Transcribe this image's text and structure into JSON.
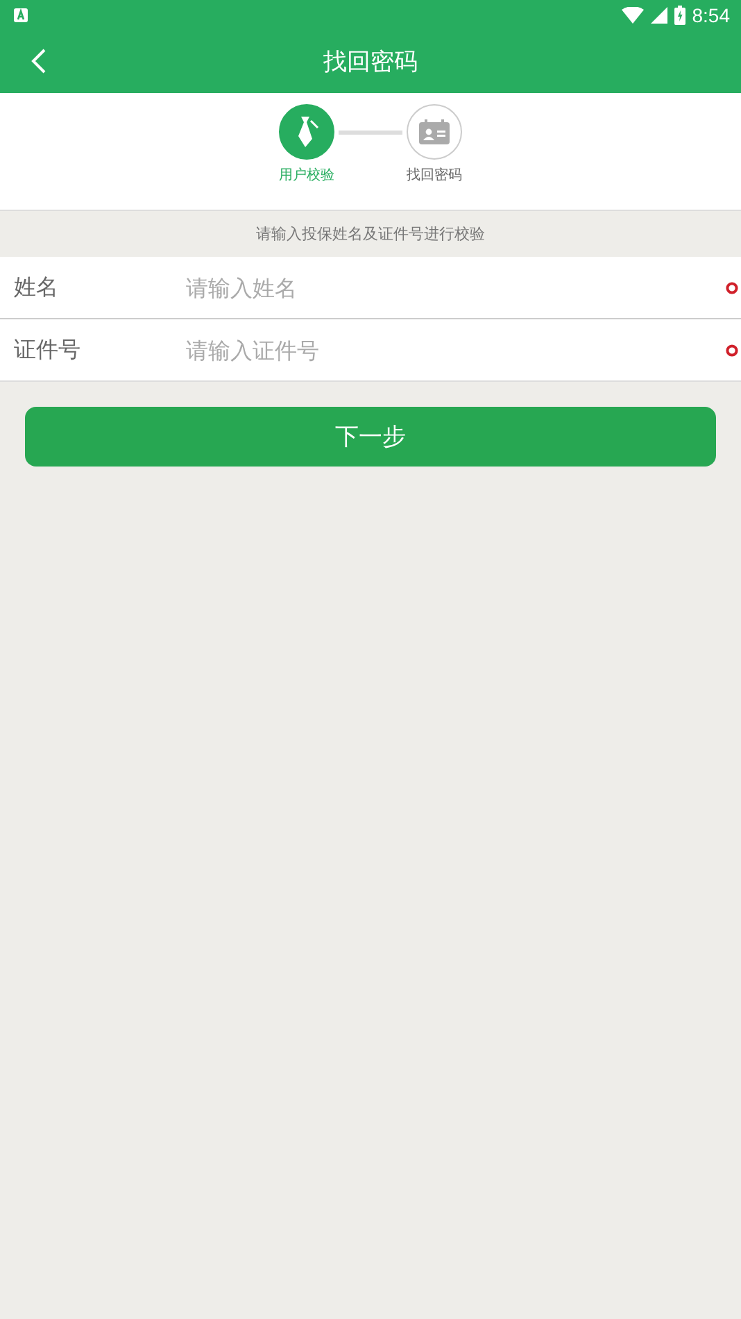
{
  "status_bar": {
    "time": "8:54"
  },
  "app_bar": {
    "title": "找回密码"
  },
  "steps": [
    {
      "label": "用户校验",
      "kind": "user",
      "selected": true
    },
    {
      "label": "找回密码",
      "kind": "card",
      "selected": false
    }
  ],
  "hint": "请输入投保姓名及证件号进行校验",
  "fields": [
    {
      "label": "姓名",
      "placeholder": "请输入姓名",
      "required": true
    },
    {
      "label": "证件号",
      "placeholder": "请输入证件号",
      "required": true
    }
  ],
  "button": "下一步"
}
